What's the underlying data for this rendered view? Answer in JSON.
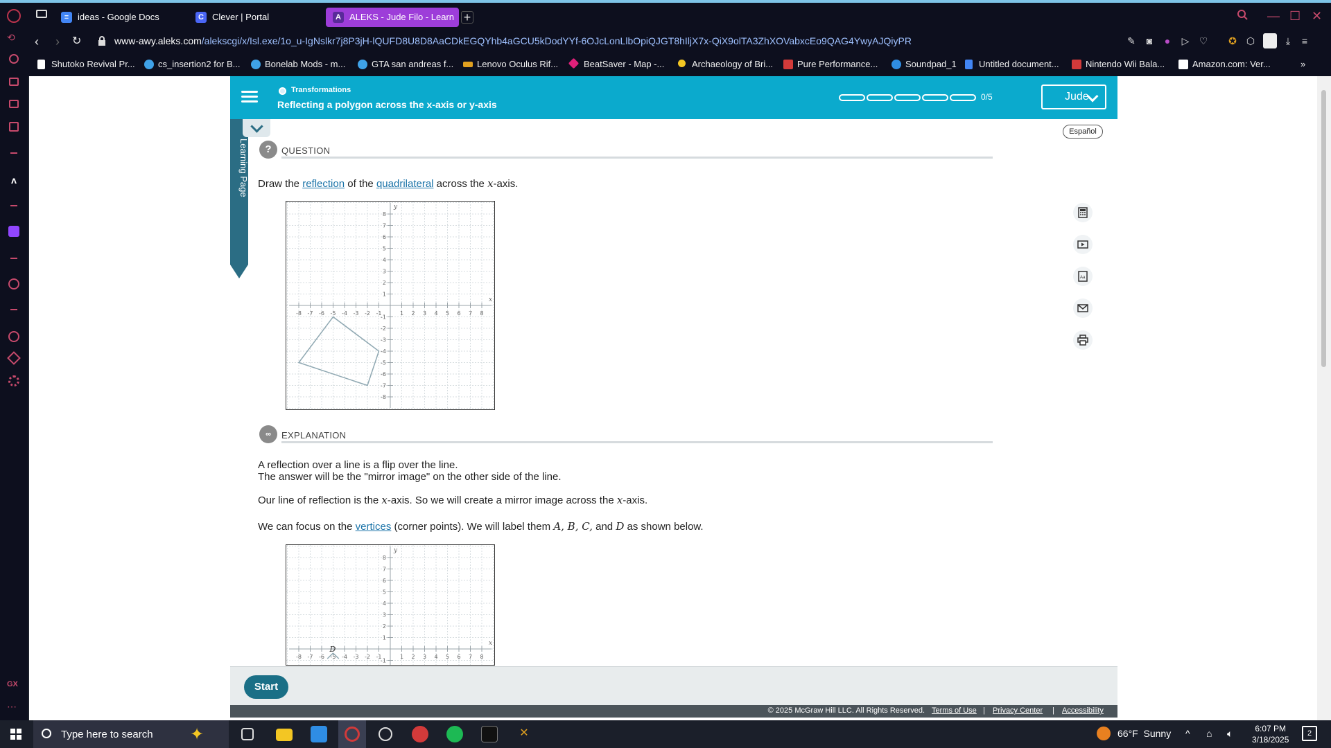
{
  "browser": {
    "tabs": [
      {
        "label": "ideas - Google Docs",
        "icon": "google-docs-icon",
        "color": "#4285f4"
      },
      {
        "label": "Clever | Portal",
        "icon": "clever-icon",
        "color": "#4a66f5"
      },
      {
        "label": "ALEKS - Jude Filo - Learn",
        "icon": "aleks-icon",
        "color": "#9d3dd9",
        "active": true
      }
    ],
    "url_host": "www-awy.aleks.com",
    "url_path": "/alekscgi/x/Isl.exe/1o_u-IgNslkr7j8P3jH-lQUFD8U8D8AaCDkEGQYhb4aGCU5kDodYYf-6OJcLonLlbOpiQJGT8hIljX7x-QiX9olTA3ZhXOVabxcEo9QAG4YwyAJQiyPR",
    "bookmarks": [
      {
        "label": "Shutoko Revival Pr...",
        "color": "#ffffff"
      },
      {
        "label": "cs_insertion2 for B...",
        "color": "#3fa2e8"
      },
      {
        "label": "Bonelab Mods - m...",
        "color": "#3fa2e8"
      },
      {
        "label": "GTA san andreas f...",
        "color": "#3fa2e8"
      },
      {
        "label": "Lenovo Oculus Rif...",
        "color": "#e0a020"
      },
      {
        "label": "BeatSaver - Map -...",
        "color": "#e0207a"
      },
      {
        "label": "Archaeology of Bri...",
        "color": "#f3c623"
      },
      {
        "label": "Pure Performance...",
        "color": "#d23a3a"
      },
      {
        "label": "Soundpad_1",
        "color": "#2f8de4"
      },
      {
        "label": "Untitled document...",
        "color": "#4285f4"
      },
      {
        "label": "Nintendo Wii Bala...",
        "color": "#d23a3a"
      },
      {
        "label": "Amazon.com: Ver...",
        "color": "#ffffff"
      }
    ]
  },
  "aleks": {
    "topic": "Transformations",
    "subtopic": "Reflecting a polygon across the x-axis or y-axis",
    "progress": {
      "done": 0,
      "total": 5,
      "label": "0/5"
    },
    "user_label": "Jude",
    "learning_page_label": "Learning Page",
    "espanol_label": "Español",
    "question_header": "QUESTION",
    "question": {
      "pre": "Draw the ",
      "link1": "reflection",
      "mid": " of the ",
      "link2": "quadrilateral",
      "post1": " across the ",
      "var": "x",
      "post2": "-axis."
    },
    "explanation_header": "EXPLANATION",
    "explanation": {
      "line1": "A reflection over a line is a flip over the line.",
      "line2": "The answer will be the \"mirror image\" on the other side of the line.",
      "line3_pre": "Our line of reflection is the ",
      "line3_var1": "x",
      "line3_mid": "-axis. So we will create a mirror image across the ",
      "line3_var2": "x",
      "line3_post": "-axis.",
      "line4_pre": "We can focus on the ",
      "line4_link": "vertices",
      "line4_mid": " (corner points). We will label them ",
      "line4_vars": "A, B, C,",
      "line4_and": " and ",
      "line4_var_d": "D",
      "line4_post": " as shown below."
    },
    "start_label": "Start",
    "footer": {
      "copyright": "© 2025 McGraw Hill LLC. All Rights Reserved.",
      "terms": "Terms of Use",
      "privacy": "Privacy Center",
      "accessibility": "Accessibility"
    },
    "tools": [
      "calculator-icon",
      "video-icon",
      "dictionary-icon",
      "mail-icon",
      "print-icon"
    ],
    "accent_color": "#0baacd"
  },
  "graph1": {
    "axis_x_label": "x",
    "axis_y_label": "y",
    "range": [
      -8,
      8
    ],
    "quadrilateral": [
      [
        -5,
        -1
      ],
      [
        -1,
        -4
      ],
      [
        -2,
        -7
      ],
      [
        -8,
        -5
      ]
    ]
  },
  "graph2": {
    "axis_x_label": "x",
    "axis_y_label": "y",
    "y_range": [
      -1,
      8
    ],
    "x_range": [
      -8,
      8
    ],
    "vertex_label": "D"
  },
  "taskbar": {
    "search_placeholder": "Type here to search",
    "weather": "66°F  Sunny",
    "time": "6:07 PM",
    "date": "3/18/2025",
    "notifications": "2"
  }
}
